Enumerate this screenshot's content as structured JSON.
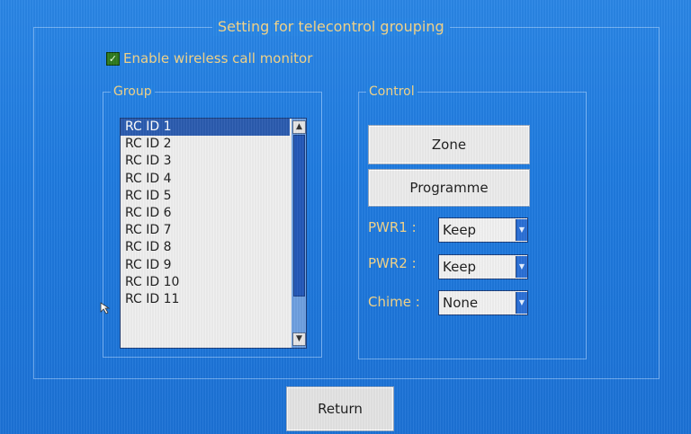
{
  "window": {
    "title": "Setting for telecontrol grouping"
  },
  "monitor": {
    "label": "Enable wireless call monitor",
    "checked": true
  },
  "group": {
    "legend": "Group",
    "items": [
      "RC ID 1",
      "RC ID 2",
      "RC ID 3",
      "RC ID 4",
      "RC ID 5",
      "RC ID 6",
      "RC ID 7",
      "RC ID 8",
      "RC ID 9",
      "RC ID 10",
      "RC ID 11"
    ],
    "selected_index": 0
  },
  "control": {
    "legend": "Control",
    "zone_label": "Zone",
    "programme_label": "Programme",
    "pwr1": {
      "label": "PWR1 :",
      "value": "Keep"
    },
    "pwr2": {
      "label": "PWR2 :",
      "value": "Keep"
    },
    "chime": {
      "label": "Chime :",
      "value": "None"
    }
  },
  "footer": {
    "return_label": "Return"
  },
  "colors": {
    "background": "#2080e4",
    "label_text": "#f3d488",
    "selection": "#2b5cb0"
  },
  "icons": {
    "checkbox": "checkmark-icon",
    "scroll_up": "arrow-up-icon",
    "scroll_down": "arrow-down-icon",
    "dropdown": "chevron-down-icon",
    "pointer": "mouse-pointer-icon"
  }
}
